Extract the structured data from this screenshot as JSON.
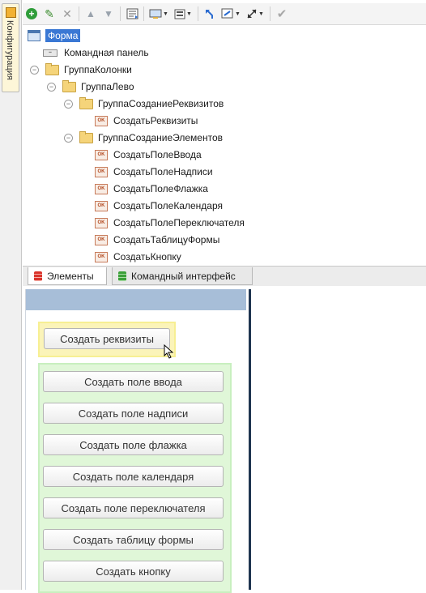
{
  "side_tab": {
    "label": "Конфигурация"
  },
  "toolbar": {
    "buttons": [
      "add-icon",
      "edit-icon",
      "delete-icon",
      "move-up-icon",
      "move-down-icon",
      "form-layout-icon",
      "view-mode-icon",
      "list-mode-icon",
      "undo-icon",
      "view-settings-icon",
      "expand-icon",
      "check-icon"
    ]
  },
  "tree": {
    "root": "Форма",
    "command_panel": "Командная панель",
    "group_columns": "ГруппаКолонки",
    "group_left": "ГруппаЛево",
    "group_create_req": "ГруппаСозданиеРеквизитов",
    "btn_create_req": "СоздатьРеквизиты",
    "group_create_elements": "ГруппаСозданиеЭлементов",
    "elements": [
      "СоздатьПолеВвода",
      "СоздатьПолеНадписи",
      "СоздатьПолеФлажка",
      "СоздатьПолеКалендаря",
      "СоздатьПолеПереключателя",
      "СоздатьТаблицуФормы",
      "СоздатьКнопку"
    ],
    "ok_badge": "OK"
  },
  "bottom_tabs": {
    "elements": "Элементы",
    "command_interface": "Командный интерфейс"
  },
  "form_preview": {
    "create_req_button": "Создать реквизиты",
    "buttons": [
      "Создать поле ввода",
      "Создать поле надписи",
      "Создать поле флажка",
      "Создать поле календаря",
      "Создать поле переключателя",
      "Создать таблицу формы",
      "Создать кнопку"
    ]
  },
  "colors": {
    "selection": "#3a78d4",
    "group_req_bg": "#fbf4b9",
    "group_elem_bg": "#e0f7d8",
    "form_header": "#a7bed8"
  }
}
